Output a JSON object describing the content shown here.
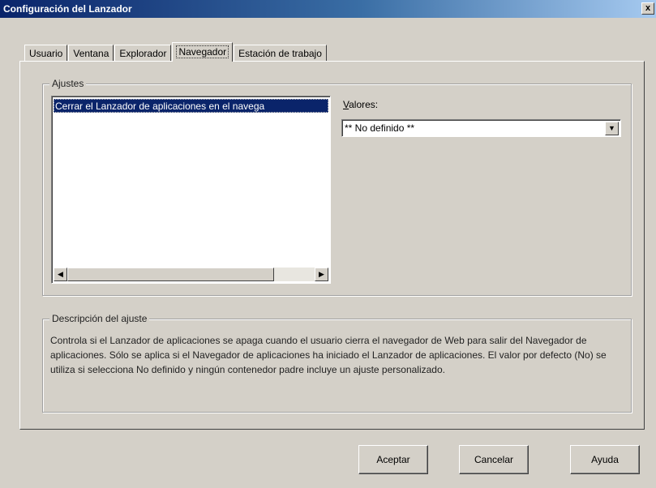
{
  "window": {
    "title": "Configuración del Lanzador",
    "close_label": "x"
  },
  "tabs": [
    {
      "label": "Usuario",
      "active": false
    },
    {
      "label": "Ventana",
      "active": false
    },
    {
      "label": "Explorador",
      "active": false
    },
    {
      "label": "Navegador",
      "active": true
    },
    {
      "label": "Estación de trabajo",
      "active": false
    }
  ],
  "settings": {
    "group_label": "Ajustes",
    "items": [
      "Cerrar el Lanzador de aplicaciones en el navega"
    ],
    "selected_index": 0,
    "values_label_accesskey": "V",
    "values_label_rest": "alores:",
    "value_selected": "** No definido **"
  },
  "description": {
    "group_label": "Descripción del ajuste",
    "text": "Controla si el Lanzador de aplicaciones se apaga cuando el usuario cierra el navegador de Web para salir del Navegador de aplicaciones. Sólo se aplica si el Navegador de aplicaciones ha iniciado el Lanzador de aplicaciones. El valor por defecto (No) se utiliza si selecciona No definido y ningún contenedor padre incluye un ajuste personalizado."
  },
  "buttons": {
    "accept": "Aceptar",
    "cancel": "Cancelar",
    "help": "Ayuda"
  },
  "icons": {
    "scroll_left": "arrow-left-icon",
    "scroll_right": "arrow-right-icon",
    "dropdown": "chevron-down-icon"
  }
}
